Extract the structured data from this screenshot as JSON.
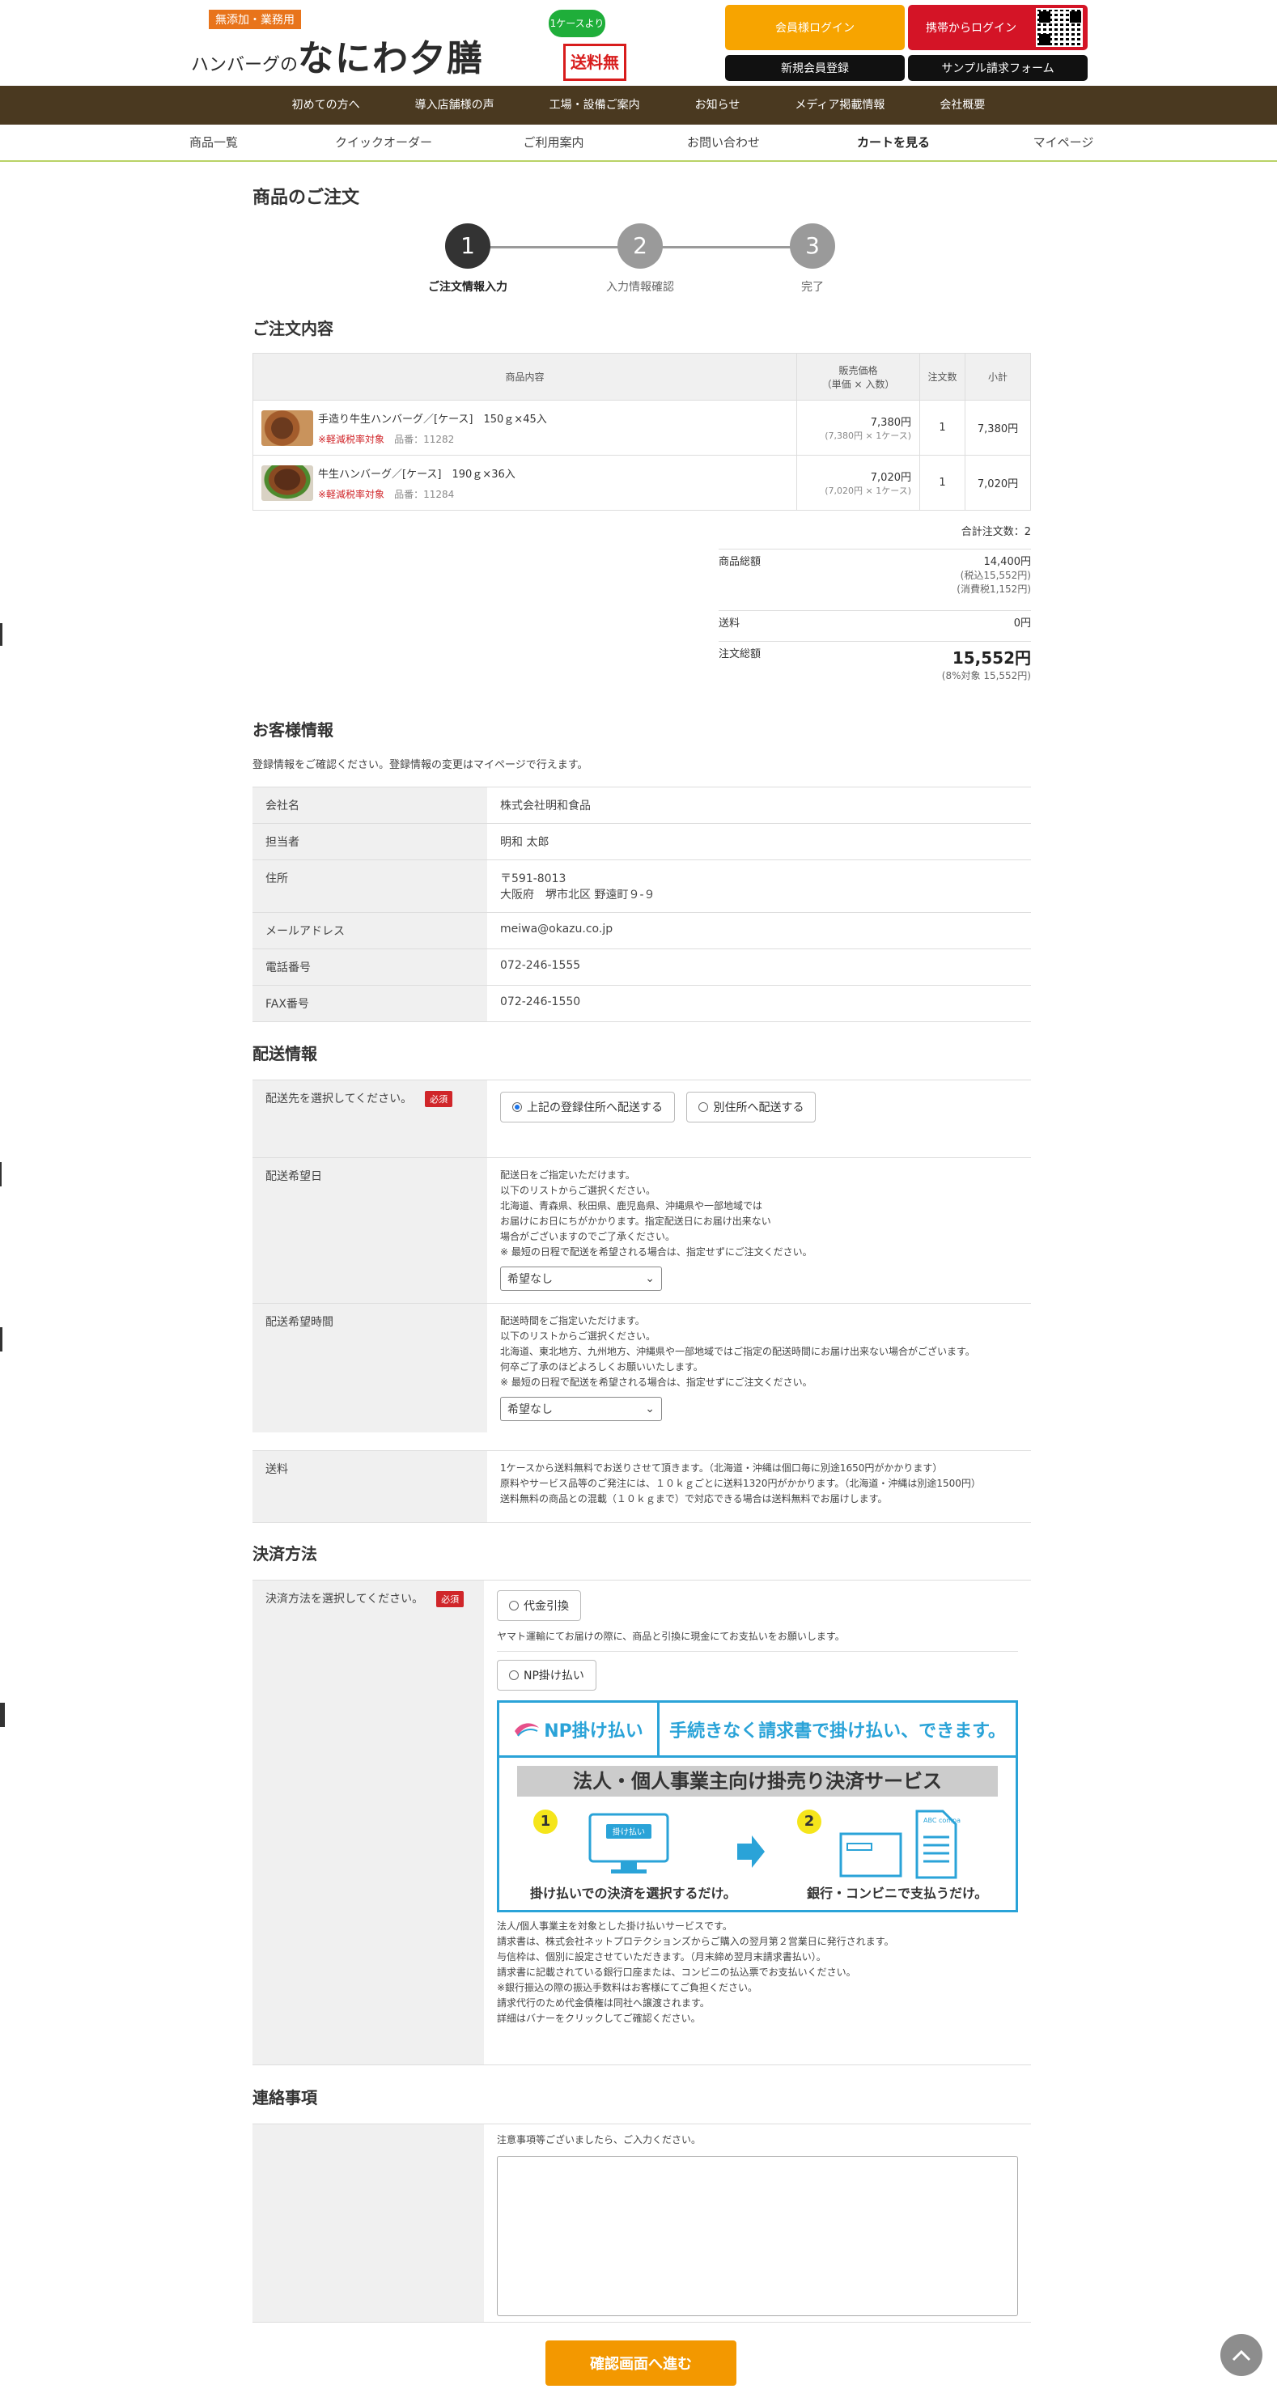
{
  "header": {
    "logo_tag": "無添加・業務用",
    "logo_small": "ハンバーグの",
    "logo_big": "なにわ夕膳",
    "free_bubble": "1ケースより",
    "free_stamp": "送料無料",
    "member_login": "会員様ログイン",
    "mobile_login": "携帯からログイン",
    "new_register": "新規会員登録",
    "sample_form": "サンプル請求フォーム"
  },
  "main_nav": [
    "初めての方へ",
    "導入店舗様の声",
    "工場・設備ご案内",
    "お知らせ",
    "メディア掲載情報",
    "会社概要"
  ],
  "sub_nav": [
    "商品一覧",
    "クイックオーダー",
    "ご利用案内",
    "お問い合わせ",
    "カートを見る",
    "マイページ"
  ],
  "page_title": "商品のご注文",
  "steps": [
    {
      "num": "1",
      "label": "ご注文情報入力"
    },
    {
      "num": "2",
      "label": "入力情報確認"
    },
    {
      "num": "3",
      "label": "完了"
    }
  ],
  "order": {
    "section_title": "ご注文内容",
    "headers": {
      "product": "商品内容",
      "price": "販売価格",
      "price_sub": "（単価 × 入数）",
      "qty": "注文数",
      "subtotal": "小計"
    },
    "items": [
      {
        "name": "手造り牛生ハンバーグ／[ケース]　150ｇ×45入",
        "tax_note": "※軽減税率対象",
        "code": "品番：11282",
        "price": "7,380円",
        "price_sub": "(7,380円 × 1ケース)",
        "qty": "1",
        "subtotal": "7,380円"
      },
      {
        "name": "牛生ハンバーグ／[ケース]　190ｇ×36入",
        "tax_note": "※軽減税率対象",
        "code": "品番：11284",
        "price": "7,020円",
        "price_sub": "(7,020円 × 1ケース)",
        "qty": "1",
        "subtotal": "7,020円"
      }
    ],
    "total_qty": "合計注文数：2",
    "goods_total_label": "商品総額",
    "goods_total": "14,400円",
    "goods_total_incl": "(税込15,552円)",
    "goods_tax": "(消費税1,152円)",
    "shipping_label": "送料",
    "shipping": "0円",
    "order_total_label": "注文総額",
    "order_total": "15,552円",
    "order_total_note": "(8%対象 15,552円)"
  },
  "customer": {
    "section_title": "お客様情報",
    "note": "登録情報をご確認ください。登録情報の変更はマイページで行えます。",
    "rows": [
      {
        "key": "会社名",
        "val": "株式会社明和食品"
      },
      {
        "key": "担当者",
        "val": "明和 太郎"
      },
      {
        "key": "住所",
        "val": "〒591-8013",
        "val2": "大阪府　堺市北区 野遠町９-９"
      },
      {
        "key": "メールアドレス",
        "val": "meiwa@okazu.co.jp"
      },
      {
        "key": "電話番号",
        "val": "072-246-1555"
      },
      {
        "key": "FAX番号",
        "val": "072-246-1550"
      }
    ]
  },
  "delivery": {
    "section_title": "配送情報",
    "dest_label": "配送先を選択してください。",
    "required": "必須",
    "opt_registered": "上記の登録住所へ配送する",
    "opt_other": "別住所へ配送する",
    "date_label": "配送希望日",
    "date_note": [
      "配送日をご指定いただけます。",
      "以下のリストからご選択ください。",
      "北海道、青森県、秋田県、鹿児島県、沖縄県や一部地域では",
      "お届けにお日にちがかかります。指定配送日にお届け出来ない",
      "場合がございますのでご了承ください。",
      "※ 最短の日程で配送を希望される場合は、指定せずにご注文ください。"
    ],
    "date_select": "希望なし",
    "time_label": "配送希望時間",
    "time_note": [
      "配送時間をご指定いただけます。",
      "以下のリストからご選択ください。",
      "北海道、東北地方、九州地方、沖縄県や一部地域ではご指定の配送時間にお届け出来ない場合がございます。",
      "何卒ご了承のほどよろしくお願いいたします。",
      "※ 最短の日程で配送を希望される場合は、指定せずにご注文ください。"
    ],
    "time_select": "希望なし",
    "fee_label": "送料",
    "fee_note": [
      "1ケースから送料無料でお送りさせて頂きます。（北海道・沖縄は個口毎に別途1650円がかかります）",
      "原料やサービス品等のご発注には、１０ｋｇごとに送料1320円がかかります。（北海道・沖縄は別途1500円）",
      "送料無料の商品との混載（１０ｋｇまで）で対応できる場合は送料無料でお届けします。"
    ]
  },
  "payment": {
    "section_title": "決済方法",
    "label": "決済方法を選択してください。",
    "required": "必須",
    "cod": "代金引換",
    "cod_note": "ヤマト運輸にてお届けの際に、商品と引換に現金にてお支払いをお願いします。",
    "np": "NP掛け払い",
    "np_logo": "NP掛け払い",
    "np_catch": "手続きなく請求書で掛け払い、できます。",
    "np_title": "法人・個人事業主向け掛売り決済サービス",
    "np_step1": "掛け払いでの決済を選択するだけ。",
    "np_step2": "銀行・コンビニで支払うだけ。",
    "np_screen": "掛け払い",
    "np_doc": "ABC company",
    "np_notes": [
      "法人/個人事業主を対象とした掛け払いサービスです。",
      "請求書は、株式会社ネットプロテクションズからご購入の翌月第２営業日に発行されます。",
      "与信枠は、個別に設定させていただきます。（月末締め翌月末請求書払い）。",
      "請求書に記載されている銀行口座または、コンビニの払込票でお支払いください。",
      "※銀行振込の際の振込手数料はお客様にてご負担ください。",
      "請求代行のため代金債権は同社へ譲渡されます。",
      "詳細はバナーをクリックしてご確認ください。"
    ]
  },
  "contact": {
    "section_title": "連絡事項",
    "note": "注意事項等ございましたら、ご入力ください。"
  },
  "confirm_button": "確認画面へ進む",
  "colors": {
    "brand_brown": "#4a3920",
    "orange": "#f7a400",
    "red": "#d41426",
    "np_blue": "#2aa3d8"
  }
}
